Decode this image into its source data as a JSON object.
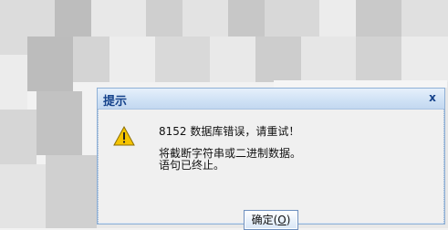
{
  "dialog": {
    "title": "提示",
    "close_glyph": "x",
    "message_lines": [
      "8152 数据库错误，请重试！",
      "将截断字符串或二进制数据。",
      "语句已终止。"
    ],
    "ok_label_prefix": "确定(",
    "ok_label_accel": "O",
    "ok_label_suffix": ")",
    "icon": "warning-triangle-icon",
    "colors": {
      "title_text": "#15428b",
      "border": "#8fb0d6",
      "icon_fill": "#f5c400"
    }
  }
}
